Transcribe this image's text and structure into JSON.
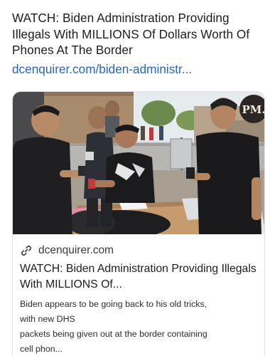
{
  "post": {
    "text": "WATCH: Biden Administration Providing Illegals With MILLIONS Of Dollars Worth Of Phones At The Border",
    "link_text": "dcenquirer.com/biden-administr..."
  },
  "card": {
    "image": {
      "alt_badge": "PM."
    },
    "domain": "dcenquirer.com",
    "title": "WATCH: Biden Administration Providing Illegals With MILLIONS Of...",
    "description_lines": [
      "Biden appears to be going back to his old tricks,",
      "with new DHS",
      "packets being given out at the border containing",
      "cell phon..."
    ]
  },
  "colors": {
    "link": "#2a64c7",
    "text": "#1c1c1e",
    "border": "#e3e3e6"
  },
  "icons": {
    "domain_icon": "link-icon"
  }
}
